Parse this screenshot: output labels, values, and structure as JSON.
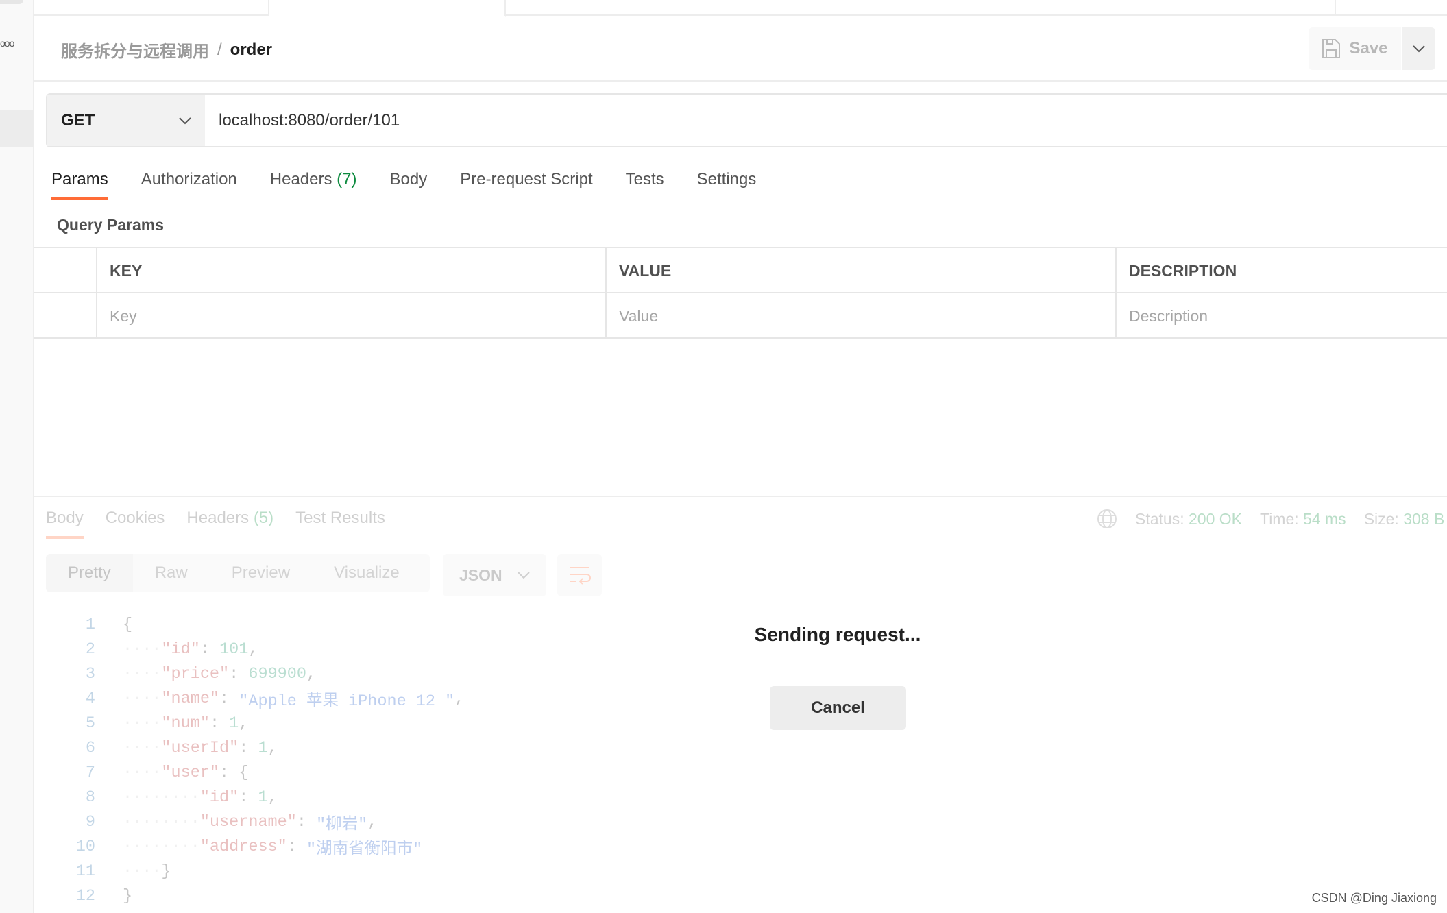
{
  "sidebar": {
    "dots": "ooo"
  },
  "breadcrumb": {
    "parent": "服务拆分与远程调用",
    "separator": "/",
    "current": "order"
  },
  "header": {
    "save_label": "Save"
  },
  "request": {
    "method": "GET",
    "url": "localhost:8080/order/101"
  },
  "request_tabs": [
    {
      "label": "Params",
      "active": true
    },
    {
      "label": "Authorization"
    },
    {
      "label": "Headers",
      "count": "(7)"
    },
    {
      "label": "Body"
    },
    {
      "label": "Pre-request Script"
    },
    {
      "label": "Tests"
    },
    {
      "label": "Settings"
    }
  ],
  "query_params": {
    "title": "Query Params",
    "columns": [
      "KEY",
      "VALUE",
      "DESCRIPTION"
    ],
    "placeholders": [
      "Key",
      "Value",
      "Description"
    ]
  },
  "response": {
    "tabs": [
      {
        "label": "Body",
        "active": true
      },
      {
        "label": "Cookies"
      },
      {
        "label": "Headers",
        "count": "(5)"
      },
      {
        "label": "Test Results"
      }
    ],
    "status_label": "Status:",
    "status": "200 OK",
    "time_label": "Time:",
    "time": "54 ms",
    "size_label": "Size:",
    "size": "308 B",
    "views": [
      "Pretty",
      "Raw",
      "Preview",
      "Visualize"
    ],
    "format": "JSON",
    "code_lines": [
      [
        [
          "pu",
          "{"
        ]
      ],
      [
        [
          "ws",
          "····"
        ],
        [
          "k",
          "\"id\""
        ],
        [
          "pu",
          ": "
        ],
        [
          "n",
          "101"
        ],
        [
          "pu",
          ","
        ]
      ],
      [
        [
          "ws",
          "····"
        ],
        [
          "k",
          "\"price\""
        ],
        [
          "pu",
          ": "
        ],
        [
          "n",
          "699900"
        ],
        [
          "pu",
          ","
        ]
      ],
      [
        [
          "ws",
          "····"
        ],
        [
          "k",
          "\"name\""
        ],
        [
          "pu",
          ": "
        ],
        [
          "s",
          "\"Apple 苹果 iPhone 12 \""
        ],
        [
          "pu",
          ","
        ]
      ],
      [
        [
          "ws",
          "····"
        ],
        [
          "k",
          "\"num\""
        ],
        [
          "pu",
          ": "
        ],
        [
          "n",
          "1"
        ],
        [
          "pu",
          ","
        ]
      ],
      [
        [
          "ws",
          "····"
        ],
        [
          "k",
          "\"userId\""
        ],
        [
          "pu",
          ": "
        ],
        [
          "n",
          "1"
        ],
        [
          "pu",
          ","
        ]
      ],
      [
        [
          "ws",
          "····"
        ],
        [
          "k",
          "\"user\""
        ],
        [
          "pu",
          ": {"
        ]
      ],
      [
        [
          "ws",
          "········"
        ],
        [
          "k",
          "\"id\""
        ],
        [
          "pu",
          ": "
        ],
        [
          "n",
          "1"
        ],
        [
          "pu",
          ","
        ]
      ],
      [
        [
          "ws",
          "········"
        ],
        [
          "k",
          "\"username\""
        ],
        [
          "pu",
          ": "
        ],
        [
          "s",
          "\"柳岩\""
        ],
        [
          "pu",
          ","
        ]
      ],
      [
        [
          "ws",
          "········"
        ],
        [
          "k",
          "\"address\""
        ],
        [
          "pu",
          ": "
        ],
        [
          "s",
          "\"湖南省衡阳市\""
        ]
      ],
      [
        [
          "ws",
          "····"
        ],
        [
          "pu",
          "}"
        ]
      ],
      [
        [
          "pu",
          "}"
        ]
      ]
    ]
  },
  "overlay": {
    "message": "Sending request...",
    "cancel_label": "Cancel"
  },
  "watermark": "CSDN @Ding Jiaxiong",
  "colors": {
    "accent": "#ff6c37",
    "success": "#0c8a3e"
  }
}
